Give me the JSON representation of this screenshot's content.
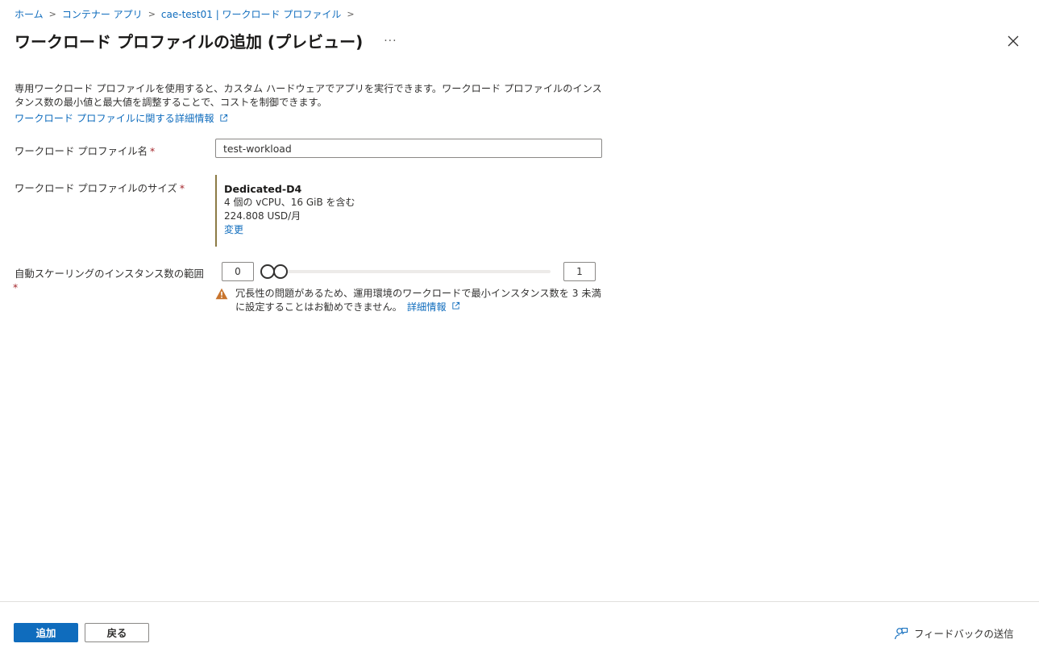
{
  "breadcrumb": {
    "items": [
      "ホーム",
      "コンテナー アプリ",
      "cae-test01 | ワークロード プロファイル"
    ]
  },
  "header": {
    "title": "ワークロード プロファイルの追加 (プレビュー)",
    "more": "···"
  },
  "description": {
    "text": "専用ワークロード プロファイルを使用すると、カスタム ハードウェアでアプリを実行できます。ワークロード プロファイルのインスタンス数の最小値と最大値を調整することで、コストを制御できます。",
    "link": "ワークロード プロファイルに関する詳細情報"
  },
  "form": {
    "name_label": "ワークロード プロファイル名",
    "name_value": "test-workload",
    "size_label": "ワークロード プロファイルのサイズ",
    "size": {
      "name": "Dedicated-D4",
      "spec": "4 個の vCPU、16 GiB を含む",
      "price": "224.808 USD/月",
      "change": "変更"
    },
    "scale_label": "自動スケーリングのインスタンス数の範囲",
    "required_mark": "*",
    "scale_min": "0",
    "scale_max": "1",
    "warning_text": "冗長性の問題があるため、運用環境のワークロードで最小インスタンス数を 3 未満に設定することはお勧めできません。",
    "warning_link": "詳細情報"
  },
  "footer": {
    "add": "追加",
    "back": "戻る",
    "feedback": "フィードバックの送信"
  },
  "colors": {
    "accent": "#0f6cbd",
    "warning": "#c19c00",
    "size_border": "#8c7b45"
  }
}
